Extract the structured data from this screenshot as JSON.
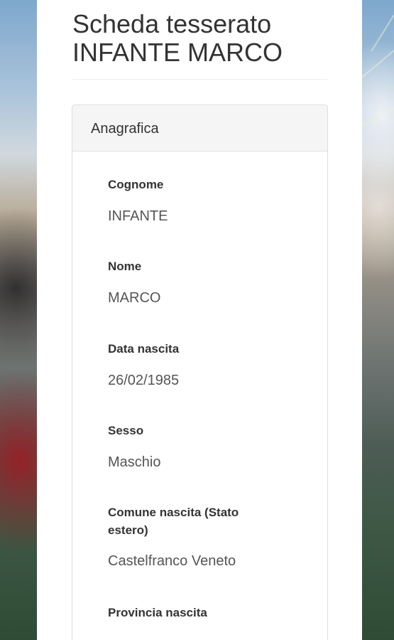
{
  "page": {
    "title_line1": "Scheda tesserato",
    "title_line2": "INFANTE MARCO"
  },
  "panel": {
    "heading": "Anagrafica",
    "fields": [
      {
        "label": "Cognome",
        "value": "INFANTE"
      },
      {
        "label": "Nome",
        "value": "MARCO"
      },
      {
        "label": "Data nascita",
        "value": "26/02/1985"
      },
      {
        "label": "Sesso",
        "value": "Maschio"
      },
      {
        "label": "Comune nascita (Stato estero)",
        "value": "Castelfranco Veneto"
      },
      {
        "label": "Provincia nascita",
        "value": ""
      }
    ]
  },
  "colors": {
    "panel_heading_bg": "#f5f5f5",
    "border": "#dddddd",
    "text": "#333333",
    "value_text": "#555555"
  }
}
